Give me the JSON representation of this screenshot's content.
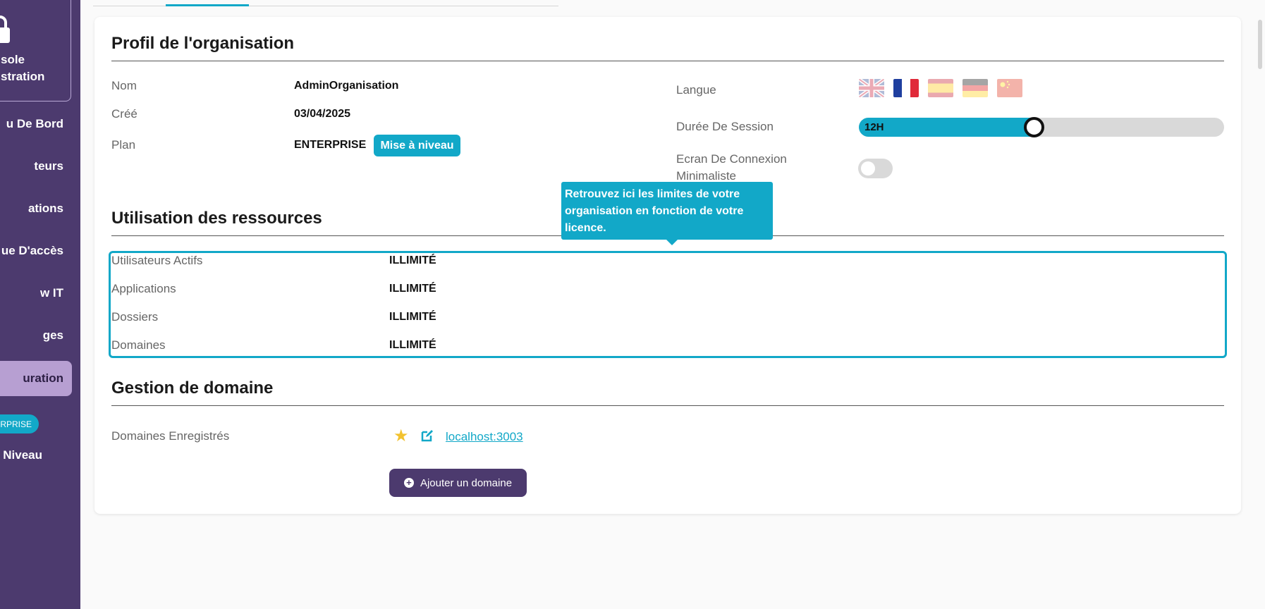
{
  "sidebar": {
    "admin_label_line1": "sole",
    "admin_label_line2": "stration",
    "items": [
      {
        "label": "u De Bord"
      },
      {
        "label": "teurs"
      },
      {
        "label": "ations"
      },
      {
        "label": "ue D'accès"
      },
      {
        "label": "w IT"
      },
      {
        "label": "ges"
      },
      {
        "label": "uration"
      }
    ],
    "plan_badge": "RPRISE",
    "upgrade_label": "Niveau"
  },
  "profile": {
    "title": "Profil de l'organisation",
    "name_label": "Nom",
    "name_value": "AdminOrganisation",
    "created_label": "Créé",
    "created_value": "03/04/2025",
    "plan_label": "Plan",
    "plan_value": "ENTERPRISE",
    "upgrade_button": "Mise à niveau",
    "language_label": "Langue",
    "languages": [
      {
        "code": "en",
        "icon": "flag-uk-icon",
        "selected": false
      },
      {
        "code": "fr",
        "icon": "flag-france-icon",
        "selected": true
      },
      {
        "code": "es",
        "icon": "flag-spain-icon",
        "selected": false
      },
      {
        "code": "de",
        "icon": "flag-germany-icon",
        "selected": false
      },
      {
        "code": "zh",
        "icon": "flag-china-icon",
        "selected": false
      }
    ],
    "session_label": "Durée De Session",
    "session_value": "12H",
    "session_fraction": 0.48,
    "minimal_login_label": "Ecran De Connexion Minimaliste",
    "minimal_login_enabled": false
  },
  "tooltip": {
    "text": "Retrouvez ici les limites de votre organisation en fonction de votre licence."
  },
  "resources": {
    "title": "Utilisation des ressources",
    "rows": [
      {
        "label": "Utilisateurs Actifs",
        "value": "ILLIMITÉ"
      },
      {
        "label": "Applications",
        "value": "ILLIMITÉ"
      },
      {
        "label": "Dossiers",
        "value": "ILLIMITÉ"
      },
      {
        "label": "Domaines",
        "value": "ILLIMITÉ"
      }
    ]
  },
  "domains": {
    "title": "Gestion de domaine",
    "registered_label": "Domaines Enregistrés",
    "domain": "localhost:3003",
    "add_button": "Ajouter un domaine"
  },
  "colors": {
    "sidebar": "#4c3a6e",
    "accent": "#12a8c8",
    "active_nav": "#b79fd2"
  }
}
